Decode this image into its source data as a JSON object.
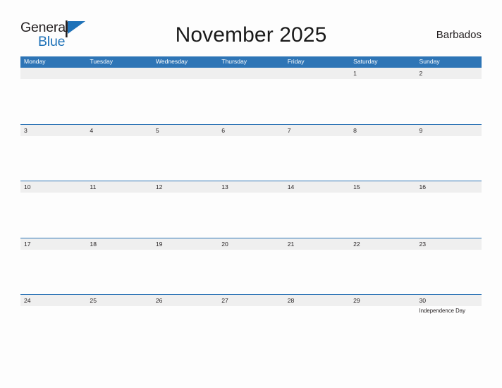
{
  "brand": {
    "name_part1": "General",
    "name_part2": "Blue",
    "flag_icon": "flag-triangle-icon",
    "accent_color": "#1f72b8"
  },
  "header": {
    "title": "November 2025",
    "country": "Barbados"
  },
  "colors": {
    "header_blue": "#2e75b6",
    "row_band_gray": "#efefef",
    "page_background": "#fdfdfd",
    "text": "#231f20"
  },
  "calendar": {
    "weekdays": [
      "Monday",
      "Tuesday",
      "Wednesday",
      "Thursday",
      "Friday",
      "Saturday",
      "Sunday"
    ],
    "weeks": [
      {
        "days": [
          {
            "date": "",
            "event": ""
          },
          {
            "date": "",
            "event": ""
          },
          {
            "date": "",
            "event": ""
          },
          {
            "date": "",
            "event": ""
          },
          {
            "date": "",
            "event": ""
          },
          {
            "date": "1",
            "event": ""
          },
          {
            "date": "2",
            "event": ""
          }
        ]
      },
      {
        "days": [
          {
            "date": "3",
            "event": ""
          },
          {
            "date": "4",
            "event": ""
          },
          {
            "date": "5",
            "event": ""
          },
          {
            "date": "6",
            "event": ""
          },
          {
            "date": "7",
            "event": ""
          },
          {
            "date": "8",
            "event": ""
          },
          {
            "date": "9",
            "event": ""
          }
        ]
      },
      {
        "days": [
          {
            "date": "10",
            "event": ""
          },
          {
            "date": "11",
            "event": ""
          },
          {
            "date": "12",
            "event": ""
          },
          {
            "date": "13",
            "event": ""
          },
          {
            "date": "14",
            "event": ""
          },
          {
            "date": "15",
            "event": ""
          },
          {
            "date": "16",
            "event": ""
          }
        ]
      },
      {
        "days": [
          {
            "date": "17",
            "event": ""
          },
          {
            "date": "18",
            "event": ""
          },
          {
            "date": "19",
            "event": ""
          },
          {
            "date": "20",
            "event": ""
          },
          {
            "date": "21",
            "event": ""
          },
          {
            "date": "22",
            "event": ""
          },
          {
            "date": "23",
            "event": ""
          }
        ]
      },
      {
        "days": [
          {
            "date": "24",
            "event": ""
          },
          {
            "date": "25",
            "event": ""
          },
          {
            "date": "26",
            "event": ""
          },
          {
            "date": "27",
            "event": ""
          },
          {
            "date": "28",
            "event": ""
          },
          {
            "date": "29",
            "event": ""
          },
          {
            "date": "30",
            "event": "Independence Day"
          }
        ]
      }
    ]
  }
}
